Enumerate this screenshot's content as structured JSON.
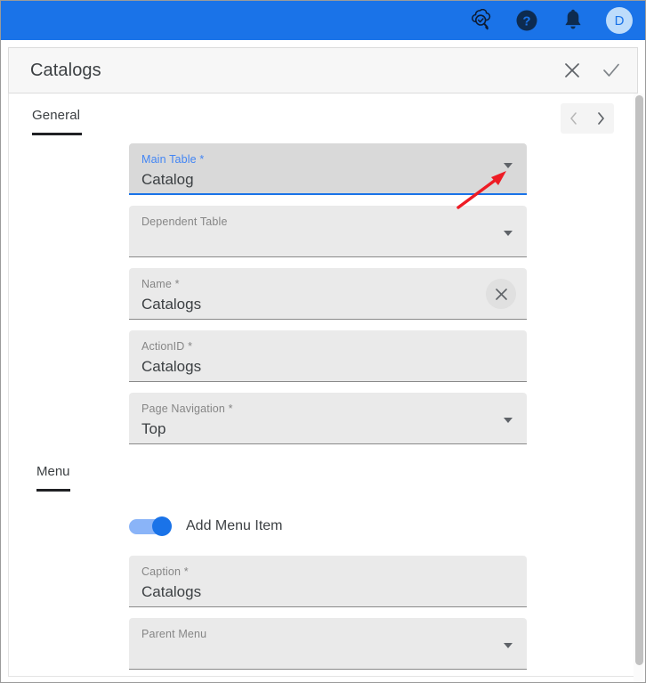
{
  "topbar": {
    "background_color": "#1a73e8",
    "icons": [
      {
        "name": "cloud-search-check-icon",
        "label": "Cloud Search"
      },
      {
        "name": "help-icon",
        "label": "Help"
      },
      {
        "name": "notifications-bell-icon",
        "label": "Notifications"
      }
    ],
    "avatar_initial": "D"
  },
  "titlebar": {
    "title": "Catalogs",
    "close_label": "Close",
    "confirm_label": "Save"
  },
  "general_section": {
    "tab_label": "General",
    "pager": {
      "prev_label": "Previous",
      "next_label": "Next"
    },
    "fields": [
      {
        "name": "main-table",
        "label": "Main Table *",
        "value": "Catalog",
        "control": "dropdown",
        "focused": true
      },
      {
        "name": "dependent-table",
        "label": "Dependent Table",
        "value": "",
        "control": "dropdown",
        "focused": false
      },
      {
        "name": "name",
        "label": "Name *",
        "value": "Catalogs",
        "control": "clear",
        "focused": false
      },
      {
        "name": "action-id",
        "label": "ActionID *",
        "value": "Catalogs",
        "control": "none",
        "focused": false
      },
      {
        "name": "page-navigation",
        "label": "Page Navigation *",
        "value": "Top",
        "control": "dropdown",
        "focused": false
      }
    ]
  },
  "menu_section": {
    "tab_label": "Menu",
    "toggle": {
      "label": "Add Menu Item",
      "checked": true,
      "on_color": "#1a73e8",
      "track_color": "#8ab4f8"
    },
    "fields": [
      {
        "name": "caption",
        "label": "Caption *",
        "value": "Catalogs",
        "control": "none",
        "focused": false
      },
      {
        "name": "parent-menu",
        "label": "Parent Menu",
        "value": "",
        "control": "dropdown",
        "focused": false
      }
    ]
  },
  "annotation": {
    "type": "arrow",
    "color": "#ee1c25",
    "points_to": "main-table-dropdown-caret"
  }
}
